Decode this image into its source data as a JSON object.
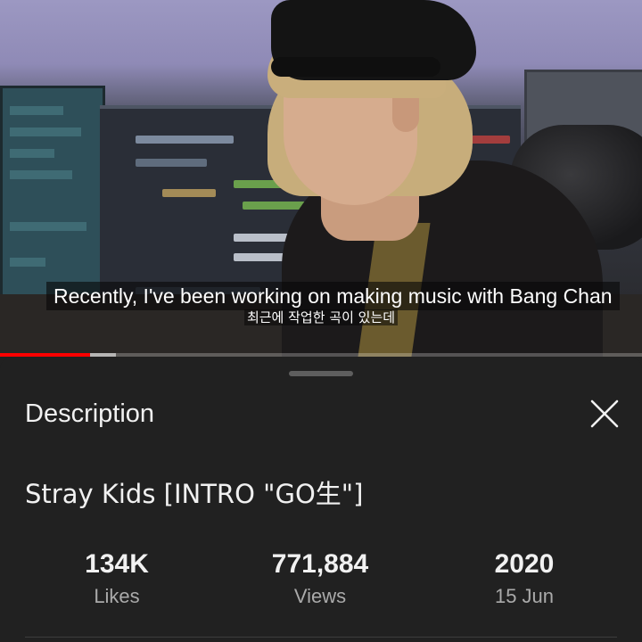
{
  "video": {
    "caption_en": "Recently, I've been working on making music with Bang Chan",
    "caption_ko": "최근에 작업한 곡이 있는데",
    "progress": {
      "played_fraction": 0.14,
      "buffered_fraction": 0.18
    },
    "accent_color": "#ff0000"
  },
  "sheet": {
    "title": "Description",
    "close_icon": "close-icon",
    "video_title": "Stray Kids [INTRO \"GO生\"]",
    "stats": [
      {
        "value": "134K",
        "label": "Likes"
      },
      {
        "value": "771,884",
        "label": "Views"
      },
      {
        "value": "2020",
        "label": "15 Jun"
      }
    ]
  }
}
